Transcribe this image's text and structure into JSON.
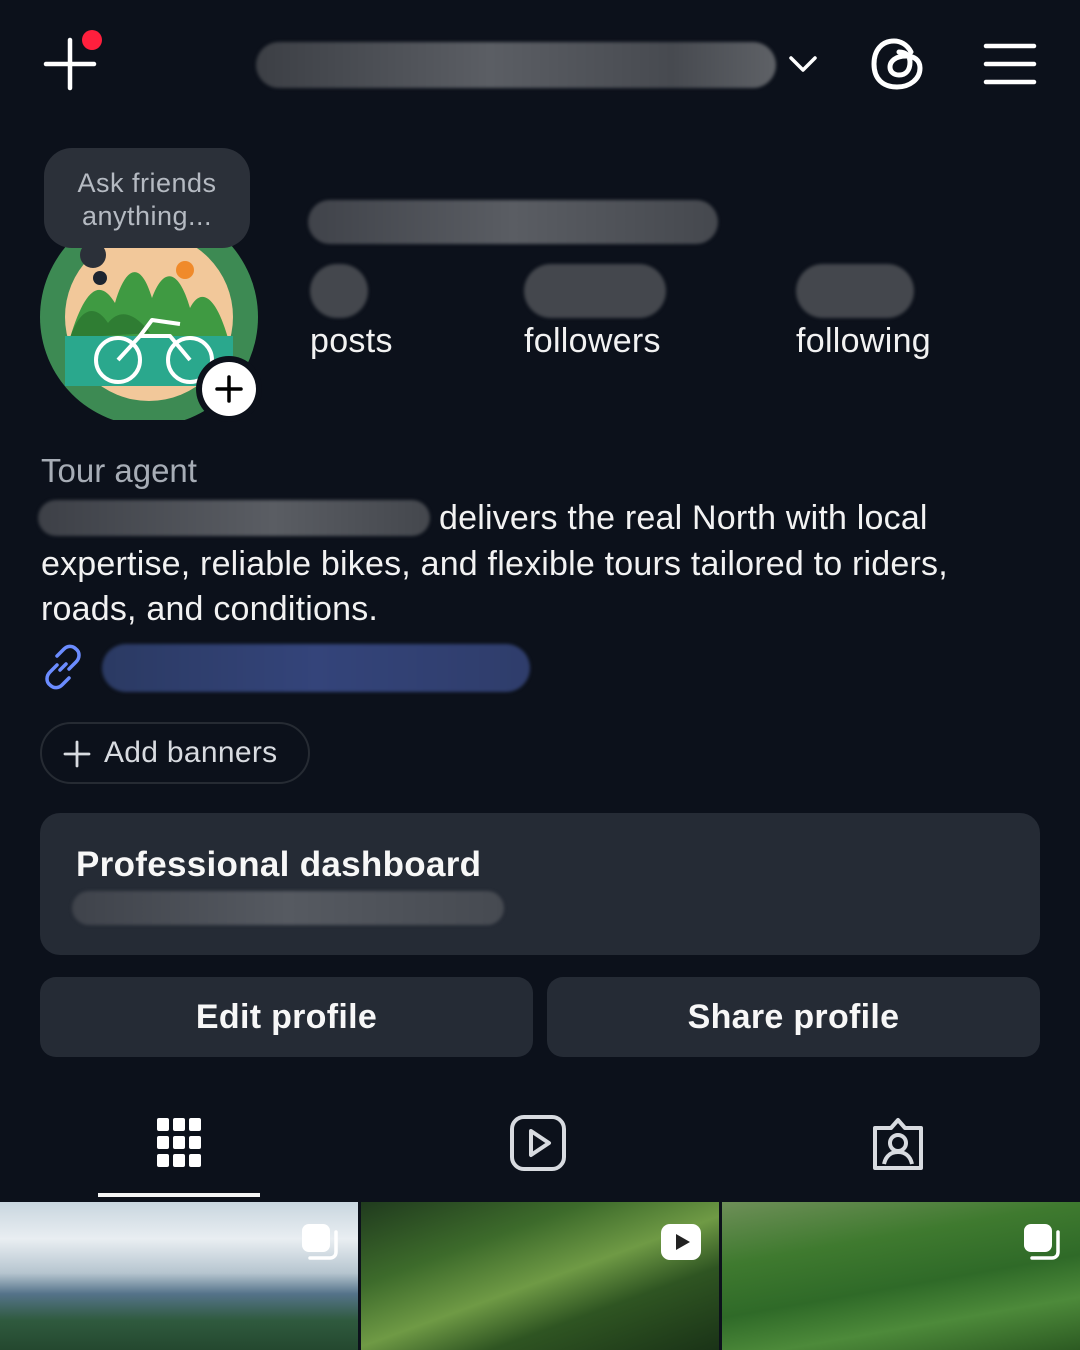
{
  "topbar": {
    "create_icon": "plus-icon",
    "has_notification": true,
    "username": "",
    "chevron_icon": "chevron-down-icon",
    "threads_icon": "threads-icon",
    "menu_icon": "hamburger-menu-icon"
  },
  "note": {
    "text": "Ask friends anything..."
  },
  "profile": {
    "avatar_icon": "motorbike-landscape-avatar",
    "add_story_icon": "plus-icon",
    "stats": [
      {
        "label": "posts"
      },
      {
        "label": "followers"
      },
      {
        "label": "following"
      }
    ],
    "category": "Tour agent",
    "bio_visible": "delivers the real North with local expertise, reliable bikes, and flexible tours tailored to riders, roads, and conditions.",
    "link_icon": "link-icon"
  },
  "banners": {
    "label": "Add banners"
  },
  "dashboard": {
    "title": "Professional dashboard"
  },
  "actions": {
    "edit": "Edit profile",
    "share": "Share profile"
  },
  "tabs": [
    {
      "icon": "grid-icon",
      "active": true
    },
    {
      "icon": "reels-icon",
      "active": false
    },
    {
      "icon": "tagged-icon",
      "active": false
    }
  ],
  "grid": [
    {
      "badge": "carousel-icon"
    },
    {
      "badge": "reel-play-icon"
    },
    {
      "badge": "carousel-icon"
    }
  ],
  "colors": {
    "background": "#0c111b",
    "card": "#252b35",
    "notification": "#ff1f3d",
    "link": "#6b8cff"
  }
}
